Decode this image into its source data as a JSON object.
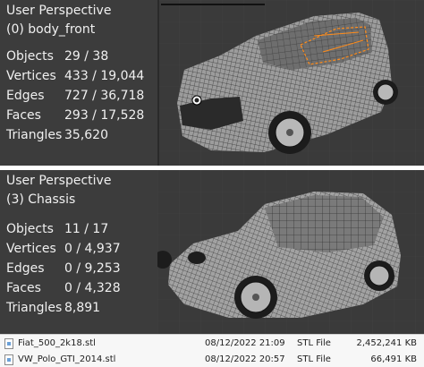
{
  "viewports": [
    {
      "perspective": "User Perspective",
      "object": "(0) body_front",
      "stats": [
        {
          "label": "Objects",
          "value": "29 / 38"
        },
        {
          "label": "Vertices",
          "value": "433 / 19,044"
        },
        {
          "label": "Edges",
          "value": "727 / 36,718"
        },
        {
          "label": "Faces",
          "value": "293 / 17,528"
        },
        {
          "label": "Triangles",
          "value": "35,620"
        }
      ]
    },
    {
      "perspective": "User Perspective",
      "object": "(3) Chassis",
      "stats": [
        {
          "label": "Objects",
          "value": "11 / 17"
        },
        {
          "label": "Vertices",
          "value": "0 / 4,937"
        },
        {
          "label": "Edges",
          "value": "0 / 9,253"
        },
        {
          "label": "Faces",
          "value": "0 / 4,328"
        },
        {
          "label": "Triangles",
          "value": "8,891"
        }
      ]
    }
  ],
  "files": [
    {
      "name": "Fiat_500_2k18.stl",
      "date": "08/12/2022 21:09",
      "type": "STL File",
      "size": "2,452,241 KB"
    },
    {
      "name": "VW_Polo_GTI_2014.stl",
      "date": "08/12/2022 20:57",
      "type": "STL File",
      "size": "66,491 KB"
    }
  ],
  "colors": {
    "viewport_bg": "#3a3a3a",
    "mesh_fill": "#9a9a9a",
    "wire": "#1a1a1a",
    "selection": "#ff8c1a",
    "file_list_bg": "#f7f7f7"
  }
}
